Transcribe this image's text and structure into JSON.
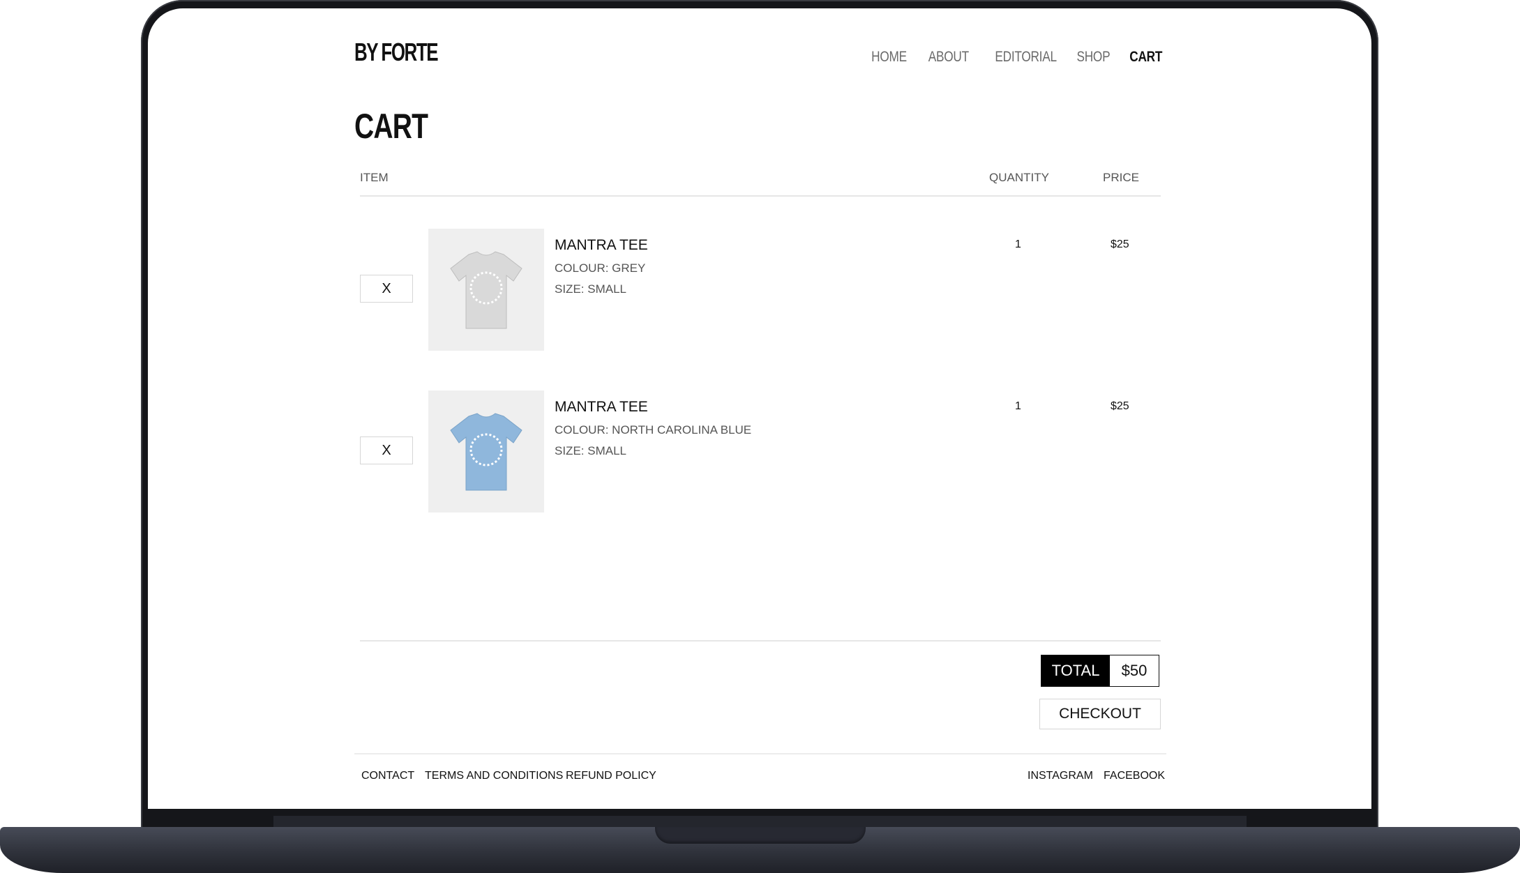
{
  "brand": {
    "logo_text": "BY FORTE"
  },
  "nav": {
    "items": [
      {
        "label": "HOME",
        "active": false
      },
      {
        "label": "ABOUT",
        "active": false
      },
      {
        "label": "EDITORIAL",
        "active": false
      },
      {
        "label": "SHOP",
        "active": false
      },
      {
        "label": "CART",
        "active": true
      }
    ]
  },
  "page": {
    "title": "CART"
  },
  "table": {
    "headers": {
      "item": "ITEM",
      "quantity": "QUANTITY",
      "price": "PRICE"
    }
  },
  "cart": {
    "items": [
      {
        "remove_label": "X",
        "name": "MANTRA TEE",
        "colour": "COLOUR: GREY",
        "size": "SIZE: SMALL",
        "quantity": "1",
        "price": "$25",
        "shirt_color": "#d9d9d9",
        "print_color": "#ffffff"
      },
      {
        "remove_label": "X",
        "name": "MANTRA TEE",
        "colour": "COLOUR: NORTH CAROLINA BLUE",
        "size": "SIZE: SMALL",
        "quantity": "1",
        "price": "$25",
        "shirt_color": "#8fb7dc",
        "print_color": "#ffffff"
      }
    ],
    "total_label": "TOTAL",
    "total_value": "$50",
    "checkout_label": "CHECKOUT"
  },
  "footer": {
    "left_links": [
      "CONTACT",
      "TERMS AND CONDITIONS",
      "REFUND POLICY"
    ],
    "right_links": [
      "INSTAGRAM",
      "FACEBOOK"
    ]
  }
}
